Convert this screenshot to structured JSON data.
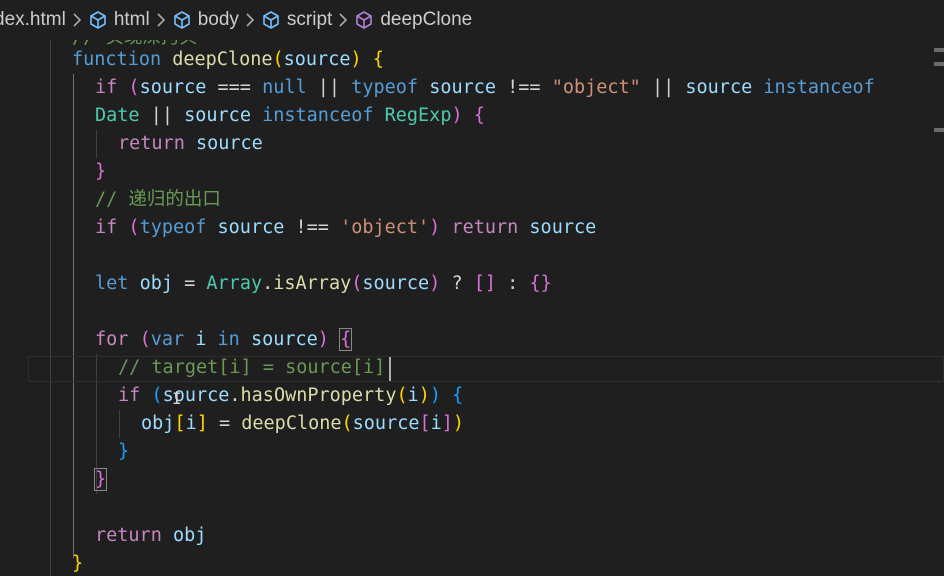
{
  "breadcrumb": {
    "file": "dex.html",
    "items": [
      "html",
      "body",
      "script",
      "deepClone"
    ]
  },
  "code": {
    "line0_comment": "// 实现深拷贝",
    "l1": {
      "kw": "function",
      "fn": "deepClone",
      "p1": "(",
      "arg": "source",
      "p2": ")",
      "sp": " ",
      "b": "{"
    },
    "l2": {
      "if": "if",
      "sp": " ",
      "p1": "(",
      "v1": "source",
      "op1": " === ",
      "null": "null",
      "op2": " || ",
      "typeof": "typeof",
      "sp2": " ",
      "v2": "source",
      "op3": " !== ",
      "str": "\"object\"",
      "op4": " || ",
      "v3": "source",
      "sp3": " ",
      "inst": "instanceof"
    },
    "l3": {
      "date": "Date",
      "op1": " || ",
      "v1": "source",
      "sp": " ",
      "inst": "instanceof",
      "sp2": " ",
      "re": "RegExp",
      "p": ")",
      "sp3": " ",
      "b": "{"
    },
    "l4": {
      "ret": "return",
      "sp": " ",
      "v": "source"
    },
    "l5": {
      "b": "}"
    },
    "l6": {
      "cmt": "// 递归的出口"
    },
    "l7": {
      "if": "if",
      "sp": " ",
      "p1": "(",
      "typeof": "typeof",
      "sp2": " ",
      "v": "source",
      "op": " !== ",
      "str": "'object'",
      "p2": ")",
      "sp3": " ",
      "ret": "return",
      "sp4": " ",
      "v2": "source"
    },
    "l8": {
      "let": "let",
      "sp": " ",
      "obj": "obj",
      "op": " = ",
      "arr": "Array",
      "dot": ".",
      "fn": "isArray",
      "p1": "(",
      "v": "source",
      "p2": ")",
      "op2": " ? ",
      "a": "[]",
      "op3": " : ",
      "o": "{}"
    },
    "l9": {
      "for": "for",
      "sp": " ",
      "p1": "(",
      "var": "var",
      "sp2": " ",
      "i": "i",
      "sp3": " ",
      "in": "in",
      "sp4": " ",
      "v": "source",
      "p2": ")",
      "sp5": " ",
      "b": "{"
    },
    "l10": {
      "cmt": "// target[i] = source[i]"
    },
    "l11": {
      "if": "if",
      "sp": " ",
      "p1": "(",
      "v": "source",
      "dot": ".",
      "fn": "hasOwnProperty",
      "p2": "(",
      "i": "i",
      "p3": ")",
      "p4": ")",
      "sp2": " ",
      "b": "{"
    },
    "l12": {
      "obj": "obj",
      "b1": "[",
      "i": "i",
      "b2": "]",
      "op": " = ",
      "fn": "deepClone",
      "p1": "(",
      "v": "source",
      "b3": "[",
      "i2": "i",
      "b4": "]",
      "p2": ")"
    },
    "l13": {
      "b": "}"
    },
    "l14": {
      "b": "}"
    },
    "l15": {
      "ret": "return",
      "sp": " ",
      "obj": "obj"
    },
    "l16": {
      "b": "}"
    }
  }
}
